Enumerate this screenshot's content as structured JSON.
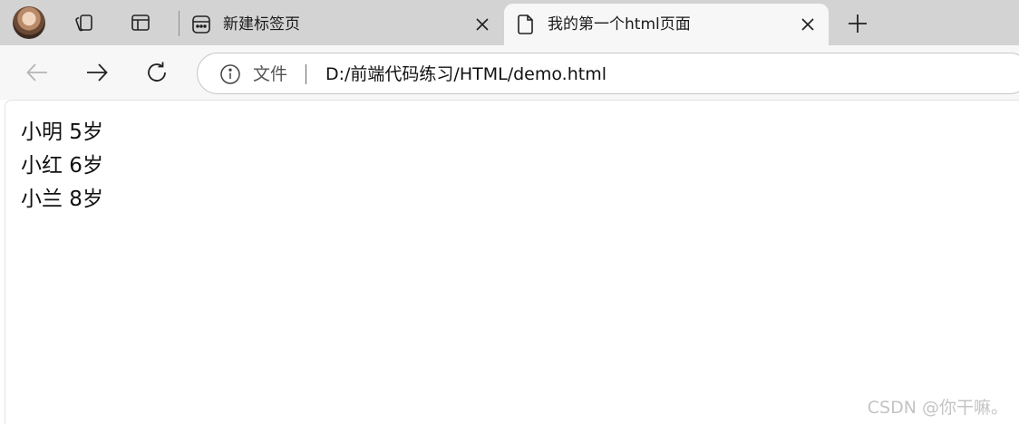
{
  "browser": {
    "profile": {
      "icon": "profile-avatar"
    },
    "tabs": [
      {
        "title": "新建标签页",
        "icon": "new-tab-page-icon",
        "active": false
      },
      {
        "title": "我的第一个html页面",
        "icon": "document-icon",
        "active": true
      }
    ],
    "icons": {
      "collections": "collections-icon",
      "vertical_tabs": "vertical-tabs-icon",
      "close": "close-icon",
      "new_tab": "plus-icon",
      "back": "back-arrow-icon",
      "forward": "forward-arrow-icon",
      "refresh": "refresh-icon",
      "info": "info-icon"
    },
    "address_bar": {
      "scheme_label": "文件",
      "url": "D:/前端代码练习/HTML/demo.html"
    }
  },
  "page": {
    "lines": [
      "小明 5岁",
      "小红 6岁",
      "小兰 8岁"
    ],
    "watermark": "CSDN @你干嘛。"
  },
  "colors": {
    "tabstrip_bg": "#d3d3d3",
    "toolbar_bg": "#f7f7f7",
    "page_bg": "#ffffff"
  }
}
